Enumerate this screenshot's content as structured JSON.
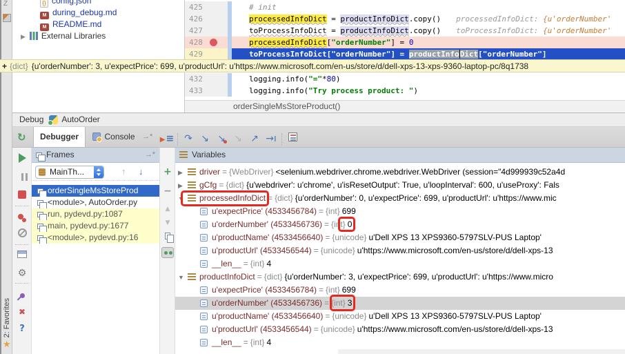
{
  "colors": {
    "annotation_red": "#e8281e",
    "execution_line_blue": "#2450c6",
    "breakpoint_line_pink": "#fbdcd4",
    "identifier_highlight_yellow": "#ffeb3b",
    "frame_library_yellow": "#ffffcc",
    "frame_selected_blue": "#3069c8",
    "panel_header_steel": "#ccd5e2"
  },
  "icons": {
    "resume": "play-triangle",
    "pause": "double-bar",
    "stop": "red-square",
    "view_breakpoints": "two-red-circles",
    "mute_breakpoints": "slashed-circle",
    "settings": "gear",
    "close": "cross",
    "help": "question-mark",
    "favorites": "star",
    "rerun": "circular-arrow",
    "step_over": "curved-arrow",
    "step_into": "down-right-arrow",
    "step_out": "up-right-arrow",
    "evaluate_expression": "calculator"
  },
  "left_bar": {
    "top_label": "Z",
    "favorites_label": "2: Favorites"
  },
  "project_tree": {
    "items": [
      {
        "label": "config.json"
      },
      {
        "label": "during_debug.md"
      },
      {
        "label": "README.md"
      },
      {
        "label": "External Libraries"
      }
    ],
    "expand_arrow": "▶"
  },
  "editor": {
    "lines": {
      "l425": {
        "num": "425",
        "comment": "# init"
      },
      "l426": {
        "num": "426",
        "name": "processedInfoDict",
        "eq": " = ",
        "ref": "productInfoDict",
        "call": ".copy()",
        "hint_name": "processedInfoDict: ",
        "hint_value": "{u'orderNumber'"
      },
      "l427": {
        "num": "427",
        "name": "toProcessInfoDict",
        "eq": " = ",
        "ref": "productInfoDict",
        "call": ".copy()",
        "hint_name": "toProcessInfoDict: ",
        "hint_value": "{u'orderNumber'"
      },
      "l428": {
        "num": "428",
        "name": "processedInfoDict",
        "open": "[",
        "string": "\"orderNumber\"",
        "close": "] = ",
        "value": "0"
      },
      "l429": {
        "num": "429",
        "pre": "toProcessInfoDict[",
        "string": "\"orderNumber\"",
        "mid": "] = ",
        "sel_a": "productInfo",
        "sel_b": "Dict",
        "tail": "[\"orderNumber\"]"
      },
      "l432": {
        "num": "432",
        "pre": "logging.info(",
        "string": "\"=\"",
        "op": "*",
        "value": "80",
        "post": ")"
      },
      "l433": {
        "num": "433",
        "pre": "logging.info(",
        "string": "\"Try process product: \"",
        "post": ")"
      }
    },
    "breadcrumb": "orderSingleMsStoreProduct()"
  },
  "value_tooltip": {
    "expander": "+",
    "type": "{dict}",
    "text": "{u'orderNumber': 3, u'expectPrice': 699, u'productUrl': u'https://www.microsoft.com/en-us/store/d/dell-xps-13-xps-9360-laptop-pc/8q1738"
  },
  "debug": {
    "title": "Debug",
    "config_name": "AutoOrder",
    "tabs": {
      "debugger": "Debugger",
      "console": "Console",
      "console_pin": "→*"
    },
    "frames": {
      "header": "Frames",
      "pin": "→*",
      "thread": "MainTh...",
      "nav_up": "↑",
      "nav_down": "↓",
      "rows": [
        {
          "label": "orderSingleMsStoreProd"
        },
        {
          "label": "<module>, AutoOrder.py"
        },
        {
          "label": "run, pydevd.py:1087"
        },
        {
          "label": "main, pydevd.py:1677"
        },
        {
          "label": "<module>, pydevd.py:16"
        }
      ]
    },
    "watch_arrows": {
      "up": "▲",
      "down": "▼"
    },
    "variables": {
      "header": "Variables",
      "expand_open": "▼",
      "expand_closed": "▶",
      "rows": [
        {
          "arrow": "▶",
          "name": "driver",
          "eq": "=",
          "type": "{WebDriver}",
          "value": "<selenium.webdriver.chrome.webdriver.WebDriver (session=\"4d999939c52a4d"
        },
        {
          "arrow": "▶",
          "name": "gCfg",
          "eq": "=",
          "type": "{dict}",
          "value": "{u'webdriver': u'chrome', u'isResetOutput': True, u'loopInterval': 600, u'useProxy': Fals"
        },
        {
          "arrow": "▼",
          "name": "processedInfoDict",
          "eq": "=",
          "type": "{dict}",
          "value": "{u'orderNumber': 0, u'expectPrice': 699, u'productUrl': u'https://www.mic"
        },
        {
          "name": "u'expectPrice' (4533456784)",
          "eq": "=",
          "type": "{int}",
          "value": "699"
        },
        {
          "name": "u'orderNumber' (4533456736)",
          "eq": "=",
          "type": "{int}",
          "value": "0"
        },
        {
          "name": "u'productName' (4533456640)",
          "eq": "=",
          "type": "{unicode}",
          "value": "u'Dell XPS 13 XPS9360-5797SLV-PUS Laptop'"
        },
        {
          "name": "u'productUrl' (4533456544)",
          "eq": "=",
          "type": "{unicode}",
          "value": "u'https://www.microsoft.com/en-us/store/d/dell-xps-13"
        },
        {
          "name": "__len__",
          "eq": "=",
          "type": "{int}",
          "value": "4"
        },
        {
          "arrow": "▼",
          "name": "productInfoDict",
          "eq": "=",
          "type": "{dict}",
          "value": "{u'orderNumber': 3, u'expectPrice': 699, u'productUrl': u'https://www.micro"
        },
        {
          "name": "u'expectPrice' (4533456784)",
          "eq": "=",
          "type": "{int}",
          "value": "699"
        },
        {
          "name": "u'orderNumber' (4533456736)",
          "eq": "=",
          "type": "{int}",
          "value": "3"
        },
        {
          "name": "u'productName' (4533456640)",
          "eq": "=",
          "type": "{unicode}",
          "value": "u'Dell XPS 13 XPS9360-5797SLV-PUS Laptop'"
        },
        {
          "name": "u'productUrl' (4533456544)",
          "eq": "=",
          "type": "{unicode}",
          "value": "u'https://www.microsoft.com/en-us/store/d/dell-xps-13"
        },
        {
          "name": "__len__",
          "eq": "=",
          "type": "{int}",
          "value": "4"
        }
      ]
    }
  }
}
